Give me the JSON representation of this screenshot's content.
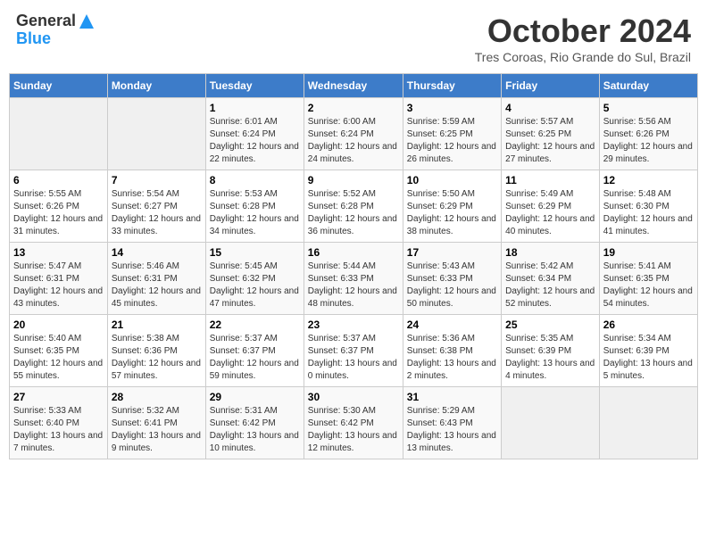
{
  "header": {
    "logo": {
      "general": "General",
      "blue": "Blue"
    },
    "title": "October 2024",
    "location": "Tres Coroas, Rio Grande do Sul, Brazil"
  },
  "weekdays": [
    "Sunday",
    "Monday",
    "Tuesday",
    "Wednesday",
    "Thursday",
    "Friday",
    "Saturday"
  ],
  "weeks": [
    [
      {
        "day": "",
        "sunrise": "",
        "sunset": "",
        "daylight": ""
      },
      {
        "day": "",
        "sunrise": "",
        "sunset": "",
        "daylight": ""
      },
      {
        "day": "1",
        "sunrise": "Sunrise: 6:01 AM",
        "sunset": "Sunset: 6:24 PM",
        "daylight": "Daylight: 12 hours and 22 minutes."
      },
      {
        "day": "2",
        "sunrise": "Sunrise: 6:00 AM",
        "sunset": "Sunset: 6:24 PM",
        "daylight": "Daylight: 12 hours and 24 minutes."
      },
      {
        "day": "3",
        "sunrise": "Sunrise: 5:59 AM",
        "sunset": "Sunset: 6:25 PM",
        "daylight": "Daylight: 12 hours and 26 minutes."
      },
      {
        "day": "4",
        "sunrise": "Sunrise: 5:57 AM",
        "sunset": "Sunset: 6:25 PM",
        "daylight": "Daylight: 12 hours and 27 minutes."
      },
      {
        "day": "5",
        "sunrise": "Sunrise: 5:56 AM",
        "sunset": "Sunset: 6:26 PM",
        "daylight": "Daylight: 12 hours and 29 minutes."
      }
    ],
    [
      {
        "day": "6",
        "sunrise": "Sunrise: 5:55 AM",
        "sunset": "Sunset: 6:26 PM",
        "daylight": "Daylight: 12 hours and 31 minutes."
      },
      {
        "day": "7",
        "sunrise": "Sunrise: 5:54 AM",
        "sunset": "Sunset: 6:27 PM",
        "daylight": "Daylight: 12 hours and 33 minutes."
      },
      {
        "day": "8",
        "sunrise": "Sunrise: 5:53 AM",
        "sunset": "Sunset: 6:28 PM",
        "daylight": "Daylight: 12 hours and 34 minutes."
      },
      {
        "day": "9",
        "sunrise": "Sunrise: 5:52 AM",
        "sunset": "Sunset: 6:28 PM",
        "daylight": "Daylight: 12 hours and 36 minutes."
      },
      {
        "day": "10",
        "sunrise": "Sunrise: 5:50 AM",
        "sunset": "Sunset: 6:29 PM",
        "daylight": "Daylight: 12 hours and 38 minutes."
      },
      {
        "day": "11",
        "sunrise": "Sunrise: 5:49 AM",
        "sunset": "Sunset: 6:29 PM",
        "daylight": "Daylight: 12 hours and 40 minutes."
      },
      {
        "day": "12",
        "sunrise": "Sunrise: 5:48 AM",
        "sunset": "Sunset: 6:30 PM",
        "daylight": "Daylight: 12 hours and 41 minutes."
      }
    ],
    [
      {
        "day": "13",
        "sunrise": "Sunrise: 5:47 AM",
        "sunset": "Sunset: 6:31 PM",
        "daylight": "Daylight: 12 hours and 43 minutes."
      },
      {
        "day": "14",
        "sunrise": "Sunrise: 5:46 AM",
        "sunset": "Sunset: 6:31 PM",
        "daylight": "Daylight: 12 hours and 45 minutes."
      },
      {
        "day": "15",
        "sunrise": "Sunrise: 5:45 AM",
        "sunset": "Sunset: 6:32 PM",
        "daylight": "Daylight: 12 hours and 47 minutes."
      },
      {
        "day": "16",
        "sunrise": "Sunrise: 5:44 AM",
        "sunset": "Sunset: 6:33 PM",
        "daylight": "Daylight: 12 hours and 48 minutes."
      },
      {
        "day": "17",
        "sunrise": "Sunrise: 5:43 AM",
        "sunset": "Sunset: 6:33 PM",
        "daylight": "Daylight: 12 hours and 50 minutes."
      },
      {
        "day": "18",
        "sunrise": "Sunrise: 5:42 AM",
        "sunset": "Sunset: 6:34 PM",
        "daylight": "Daylight: 12 hours and 52 minutes."
      },
      {
        "day": "19",
        "sunrise": "Sunrise: 5:41 AM",
        "sunset": "Sunset: 6:35 PM",
        "daylight": "Daylight: 12 hours and 54 minutes."
      }
    ],
    [
      {
        "day": "20",
        "sunrise": "Sunrise: 5:40 AM",
        "sunset": "Sunset: 6:35 PM",
        "daylight": "Daylight: 12 hours and 55 minutes."
      },
      {
        "day": "21",
        "sunrise": "Sunrise: 5:38 AM",
        "sunset": "Sunset: 6:36 PM",
        "daylight": "Daylight: 12 hours and 57 minutes."
      },
      {
        "day": "22",
        "sunrise": "Sunrise: 5:37 AM",
        "sunset": "Sunset: 6:37 PM",
        "daylight": "Daylight: 12 hours and 59 minutes."
      },
      {
        "day": "23",
        "sunrise": "Sunrise: 5:37 AM",
        "sunset": "Sunset: 6:37 PM",
        "daylight": "Daylight: 13 hours and 0 minutes."
      },
      {
        "day": "24",
        "sunrise": "Sunrise: 5:36 AM",
        "sunset": "Sunset: 6:38 PM",
        "daylight": "Daylight: 13 hours and 2 minutes."
      },
      {
        "day": "25",
        "sunrise": "Sunrise: 5:35 AM",
        "sunset": "Sunset: 6:39 PM",
        "daylight": "Daylight: 13 hours and 4 minutes."
      },
      {
        "day": "26",
        "sunrise": "Sunrise: 5:34 AM",
        "sunset": "Sunset: 6:39 PM",
        "daylight": "Daylight: 13 hours and 5 minutes."
      }
    ],
    [
      {
        "day": "27",
        "sunrise": "Sunrise: 5:33 AM",
        "sunset": "Sunset: 6:40 PM",
        "daylight": "Daylight: 13 hours and 7 minutes."
      },
      {
        "day": "28",
        "sunrise": "Sunrise: 5:32 AM",
        "sunset": "Sunset: 6:41 PM",
        "daylight": "Daylight: 13 hours and 9 minutes."
      },
      {
        "day": "29",
        "sunrise": "Sunrise: 5:31 AM",
        "sunset": "Sunset: 6:42 PM",
        "daylight": "Daylight: 13 hours and 10 minutes."
      },
      {
        "day": "30",
        "sunrise": "Sunrise: 5:30 AM",
        "sunset": "Sunset: 6:42 PM",
        "daylight": "Daylight: 13 hours and 12 minutes."
      },
      {
        "day": "31",
        "sunrise": "Sunrise: 5:29 AM",
        "sunset": "Sunset: 6:43 PM",
        "daylight": "Daylight: 13 hours and 13 minutes."
      },
      {
        "day": "",
        "sunrise": "",
        "sunset": "",
        "daylight": ""
      },
      {
        "day": "",
        "sunrise": "",
        "sunset": "",
        "daylight": ""
      }
    ]
  ]
}
